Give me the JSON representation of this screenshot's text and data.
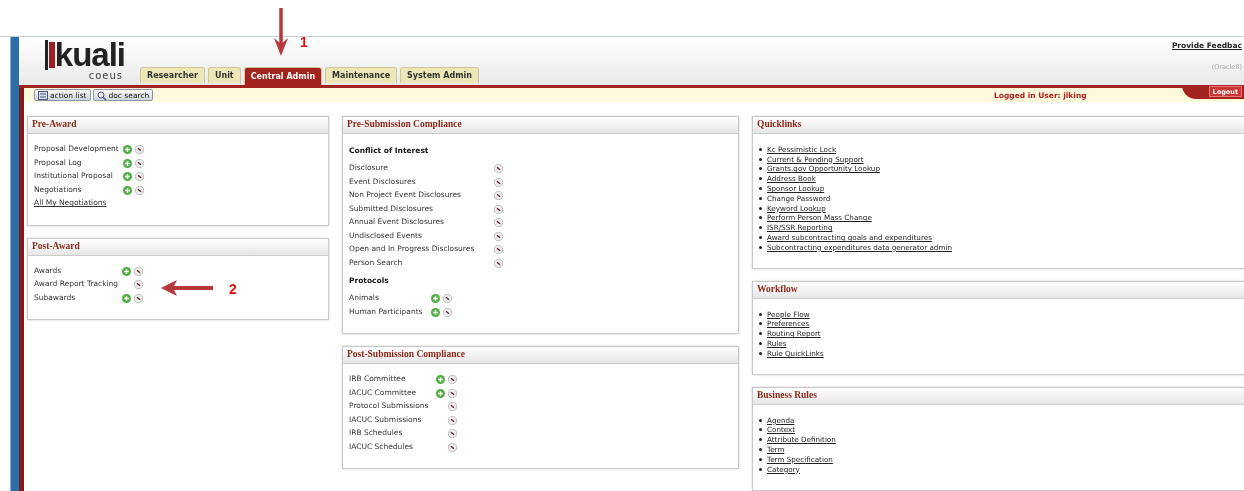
{
  "header": {
    "logo": "kuali",
    "product": "coeus",
    "feedback_link": "Provide Feedbac",
    "environment": "(Oracle8)",
    "logged_in": "Logged in User: jlking",
    "logout": "Logout"
  },
  "tabs": [
    {
      "label": "Researcher",
      "selected": false
    },
    {
      "label": "Unit",
      "selected": false
    },
    {
      "label": "Central Admin",
      "selected": true
    },
    {
      "label": "Maintenance",
      "selected": false
    },
    {
      "label": "System Admin",
      "selected": false
    }
  ],
  "toolbar": [
    "action list",
    "doc search"
  ],
  "columns": [
    [
      {
        "title": "Pre-Award",
        "groups": [
          {
            "items": [
              {
                "label": "Proposal Development",
                "kind": "tool",
                "create": true
              },
              {
                "label": "Proposal Log",
                "kind": "tool",
                "create": true
              },
              {
                "label": "Institutional Proposal",
                "kind": "tool",
                "create": true
              },
              {
                "label": "Negotiations",
                "kind": "tool",
                "create": true
              },
              {
                "label": "All My Negotiations",
                "kind": "link"
              }
            ]
          }
        ]
      },
      {
        "title": "Post-Award",
        "groups": [
          {
            "items": [
              {
                "label": "Awards",
                "kind": "tool",
                "create": true
              },
              {
                "label": "Award Report Tracking",
                "kind": "tool",
                "create": false
              },
              {
                "label": "Subawards",
                "kind": "tool",
                "create": true
              }
            ]
          }
        ]
      }
    ],
    [
      {
        "title": "Pre-Submission Compliance",
        "groups": [
          {
            "heading": "Conflict of Interest",
            "items": [
              {
                "label": "Disclosure",
                "kind": "tool",
                "create": false
              },
              {
                "label": "Event Disclosures",
                "kind": "tool",
                "create": false
              },
              {
                "label": "Non Project Event Disclosures",
                "kind": "tool",
                "create": false
              },
              {
                "label": "Submitted Disclosures",
                "kind": "tool",
                "create": false
              },
              {
                "label": "Annual Event Disclosures",
                "kind": "tool",
                "create": false
              },
              {
                "label": "Undisclosed Events",
                "kind": "tool",
                "create": false
              },
              {
                "label": "Open and In Progress Disclosures",
                "kind": "tool",
                "create": false
              },
              {
                "label": "Person Search",
                "kind": "tool",
                "create": false
              }
            ]
          },
          {
            "heading": "Protocols",
            "items": [
              {
                "label": "Animals",
                "kind": "tool",
                "create": true
              },
              {
                "label": "Human Participants",
                "kind": "tool",
                "create": true
              }
            ]
          }
        ]
      },
      {
        "title": "Post-Submission Compliance",
        "groups": [
          {
            "items": [
              {
                "label": "IRB Committee",
                "kind": "tool",
                "create": true
              },
              {
                "label": "IACUC Committee",
                "kind": "tool",
                "create": true
              },
              {
                "label": "Protocol Submissions",
                "kind": "tool",
                "create": false
              },
              {
                "label": "IACUC Submissions",
                "kind": "tool",
                "create": false
              },
              {
                "label": "IRB Schedules",
                "kind": "tool",
                "create": false
              },
              {
                "label": "IACUC Schedules",
                "kind": "tool",
                "create": false
              }
            ]
          }
        ]
      }
    ],
    [
      {
        "title": "Quicklinks",
        "groups": [
          {
            "items": [
              {
                "label": "Kc Pessimistic Lock",
                "kind": "bullet",
                "link": true
              },
              {
                "label": "Current & Pending Support",
                "kind": "bullet",
                "link": true
              },
              {
                "label": "Grants.gov Opportunity Lookup",
                "kind": "bullet",
                "link": true
              },
              {
                "label": "Address Book",
                "kind": "bullet",
                "link": true
              },
              {
                "label": "Sponsor Lookup",
                "kind": "bullet",
                "link": true
              },
              {
                "label": "Change Password",
                "kind": "bullet",
                "link": false
              },
              {
                "label": "Keyword Lookup",
                "kind": "bullet",
                "link": true
              },
              {
                "label": "Perform Person Mass Change",
                "kind": "bullet",
                "link": true
              },
              {
                "label": "ISR/SSR Reporting",
                "kind": "bullet",
                "link": true
              },
              {
                "label": "Award subcontracting goals and expenditures",
                "kind": "bullet",
                "link": true
              },
              {
                "label": "Subcontracting expenditures data generator admin",
                "kind": "bullet",
                "link": true
              }
            ]
          }
        ]
      },
      {
        "title": "Workflow",
        "groups": [
          {
            "items": [
              {
                "label": "People Flow",
                "kind": "bullet",
                "link": true
              },
              {
                "label": "Preferences",
                "kind": "bullet",
                "link": true
              },
              {
                "label": "Routing Report",
                "kind": "bullet",
                "link": true
              },
              {
                "label": "Rules",
                "kind": "bullet",
                "link": true
              },
              {
                "label": "Rule QuickLinks",
                "kind": "bullet",
                "link": true
              }
            ]
          }
        ]
      },
      {
        "title": "Business Rules",
        "groups": [
          {
            "items": [
              {
                "label": "Agenda",
                "kind": "bullet",
                "link": true
              },
              {
                "label": "Context",
                "kind": "bullet",
                "link": true
              },
              {
                "label": "Attribute Definition",
                "kind": "bullet",
                "link": true
              },
              {
                "label": "Term",
                "kind": "bullet",
                "link": true
              },
              {
                "label": "Term Specification",
                "kind": "bullet",
                "link": true
              },
              {
                "label": "Category",
                "kind": "bullet",
                "link": true
              }
            ]
          }
        ]
      }
    ]
  ],
  "callouts": [
    {
      "number": "1",
      "kind": "down"
    },
    {
      "number": "2",
      "kind": "left"
    }
  ]
}
